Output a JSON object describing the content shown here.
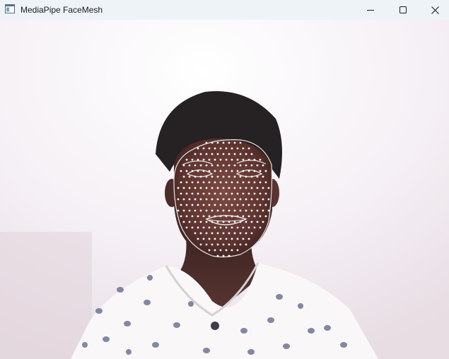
{
  "window": {
    "title": "MediaPipe FaceMesh",
    "icon": "app-window-icon",
    "controls": [
      "minimize-icon",
      "maximize-icon",
      "close-icon"
    ]
  },
  "viewport": {
    "content": "webcam-frame-with-face-mesh-overlay",
    "landmark_color": "#ffffff",
    "mesh_line_color": "#e6e6e6"
  }
}
